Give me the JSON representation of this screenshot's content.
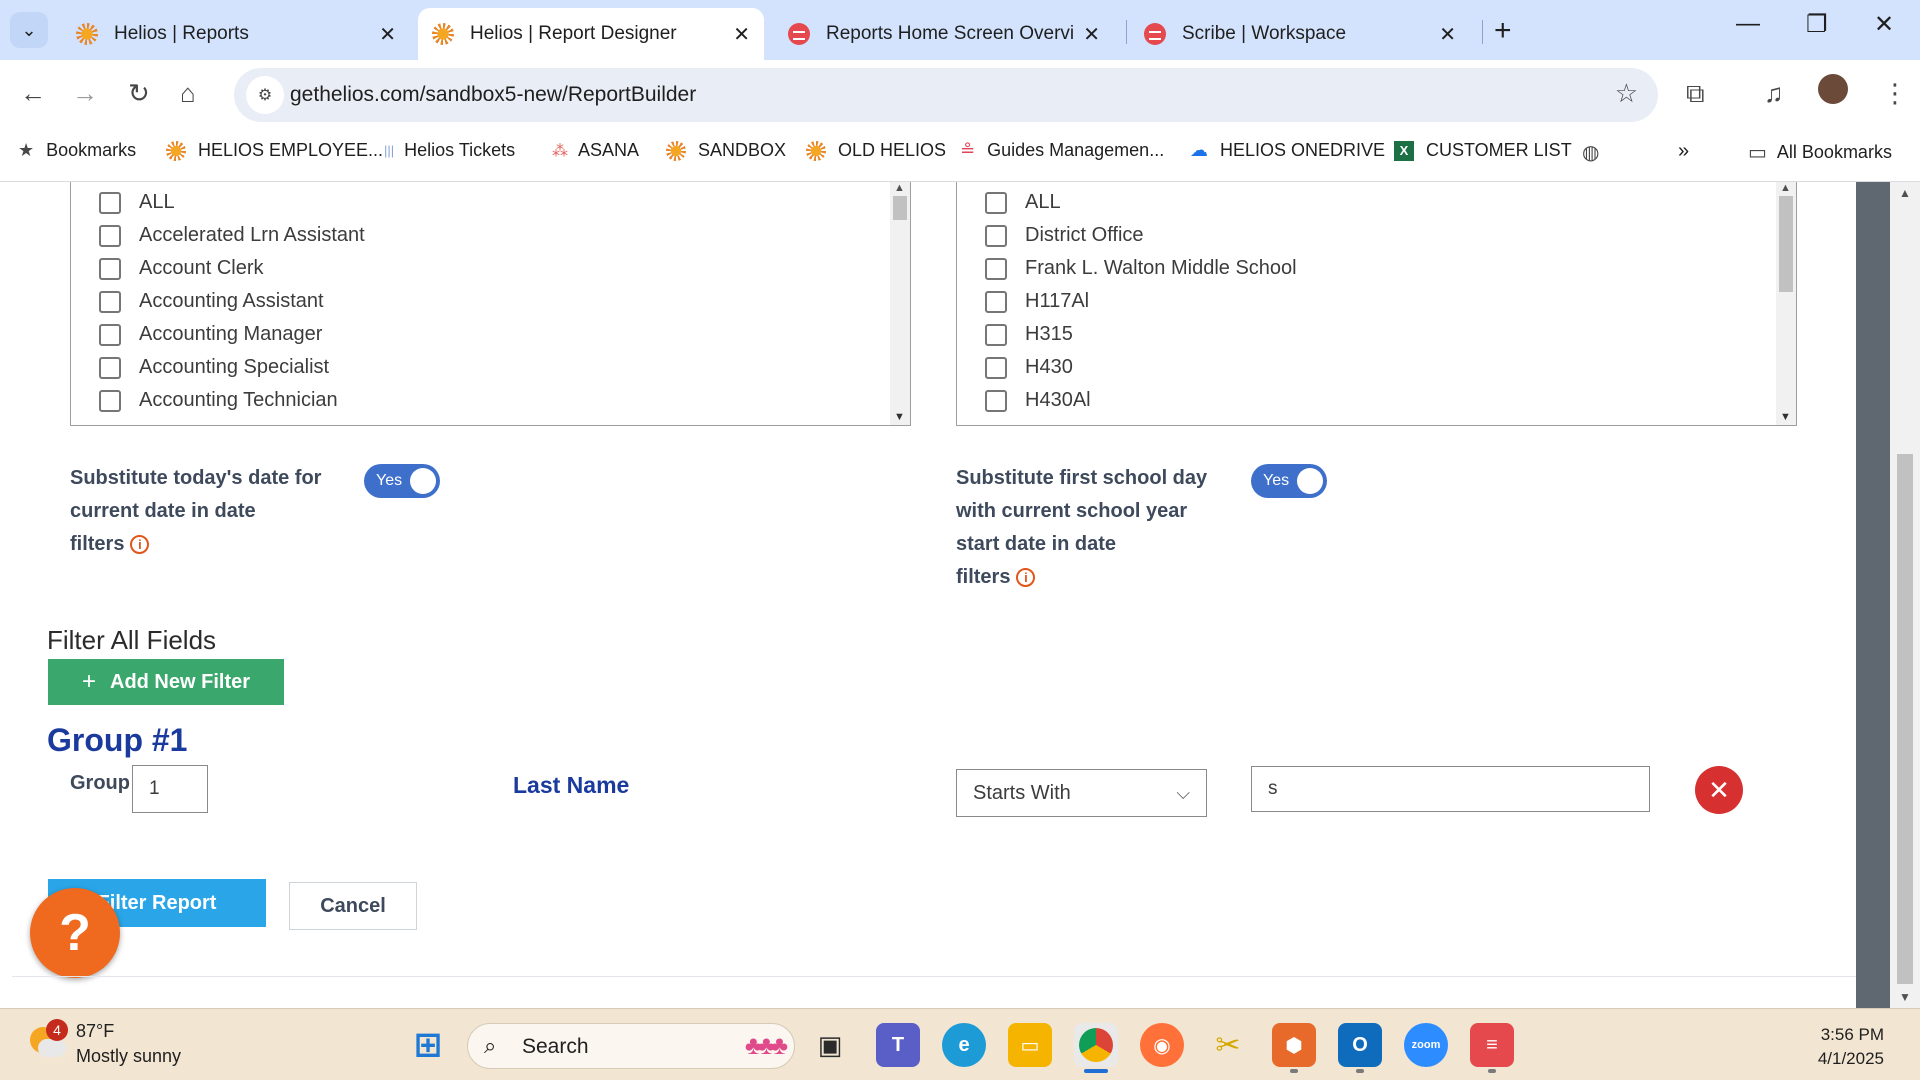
{
  "browser": {
    "tabs": [
      {
        "title": "Helios | Reports",
        "favicon": "helios-sun-icon",
        "active": false
      },
      {
        "title": "Helios | Report Designer",
        "favicon": "helios-sun-icon",
        "active": true
      },
      {
        "title": "Reports Home Screen Overview",
        "favicon": "scribe-icon",
        "active": false
      },
      {
        "title": "Scribe | Workspace",
        "favicon": "scribe-icon",
        "active": false
      }
    ],
    "url": "gethelios.com/sandbox5-new/ReportBuilder",
    "bookmarks": [
      {
        "label": "Bookmarks",
        "icon": "star-icon"
      },
      {
        "label": "HELIOS EMPLOYEE...",
        "icon": "helios-sun-icon"
      },
      {
        "label": "Helios Tickets",
        "icon": "helios-logo-icon"
      },
      {
        "label": "ASANA",
        "icon": "asana-icon"
      },
      {
        "label": "SANDBOX",
        "icon": "helios-sun-icon"
      },
      {
        "label": "OLD HELIOS",
        "icon": "helios-sun-icon"
      },
      {
        "label": "Guides Managemen...",
        "icon": "guides-icon"
      },
      {
        "label": "HELIOS ONEDRIVE",
        "icon": "onedrive-icon"
      },
      {
        "label": "CUSTOMER LIST",
        "icon": "excel-icon"
      }
    ],
    "all_bookmarks_label": "All Bookmarks"
  },
  "filters": {
    "position_list": {
      "items": [
        "ALL",
        "Accelerated Lrn Assistant",
        "Account Clerk",
        "Accounting Assistant",
        "Accounting Manager",
        "Accounting Specialist",
        "Accounting Technician"
      ]
    },
    "location_list": {
      "items": [
        "ALL",
        "District Office",
        "Frank L. Walton Middle School",
        "H117Al",
        "H315",
        "H430",
        "H430Al"
      ]
    },
    "options": {
      "today_date": {
        "lines": [
          "Substitute today's date for",
          "current date in date",
          "filters"
        ],
        "toggle_label": "Yes"
      },
      "school_day": {
        "lines": [
          "Substitute first school day",
          "with current school year",
          "start date in date",
          "filters"
        ],
        "toggle_label": "Yes"
      }
    },
    "filter_all_fields": {
      "title": "Filter All Fields",
      "add_button": "Add New Filter"
    },
    "group": {
      "title": "Group #1",
      "group_label": "Group",
      "group_value": "1",
      "field": "Last Name",
      "operator": "Starts With",
      "value": "s"
    },
    "actions": {
      "filter_button": "Filter Report",
      "cancel_button": "Cancel",
      "help_label": "?"
    }
  },
  "taskbar": {
    "weather": {
      "temp": "87°F",
      "desc": "Mostly sunny",
      "badge": "4"
    },
    "search_label": "Search",
    "time": "3:56 PM",
    "date": "4/1/2025"
  },
  "colors": {
    "accent_blue": "#1a3a9e",
    "toggle": "#3e6fcb",
    "green": "#3aa76d",
    "filter_blue": "#2aa6e8",
    "danger": "#d63030",
    "help_orange": "#ef6a1f"
  }
}
